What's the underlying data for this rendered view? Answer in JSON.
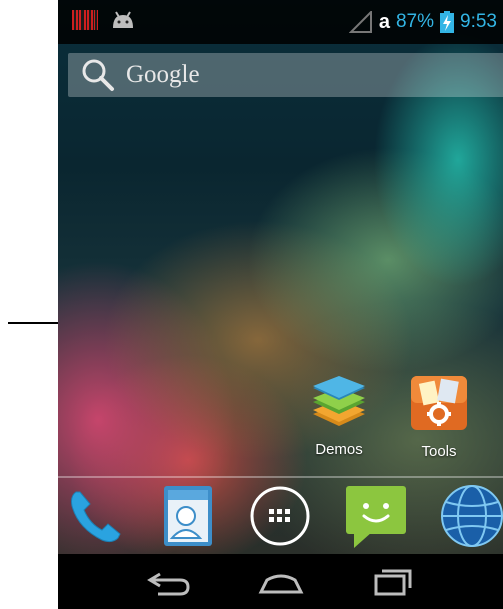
{
  "status_bar": {
    "carrier": "a",
    "battery": "87%",
    "time": "9:53"
  },
  "search": {
    "label": "Google"
  },
  "apps": [
    {
      "label": "Demos",
      "icon": "layers-icon"
    },
    {
      "label": "Tools",
      "icon": "tools-icon"
    }
  ],
  "dock": [
    {
      "icon": "phone-icon"
    },
    {
      "icon": "contacts-icon"
    },
    {
      "icon": "app-drawer-icon"
    },
    {
      "icon": "messaging-icon"
    },
    {
      "icon": "browser-globe-icon"
    }
  ],
  "nav": [
    {
      "icon": "back-icon"
    },
    {
      "icon": "home-icon"
    },
    {
      "icon": "recents-icon"
    }
  ],
  "colors": {
    "status_accent": "#33b5e5",
    "nav_bg": "#000000"
  }
}
